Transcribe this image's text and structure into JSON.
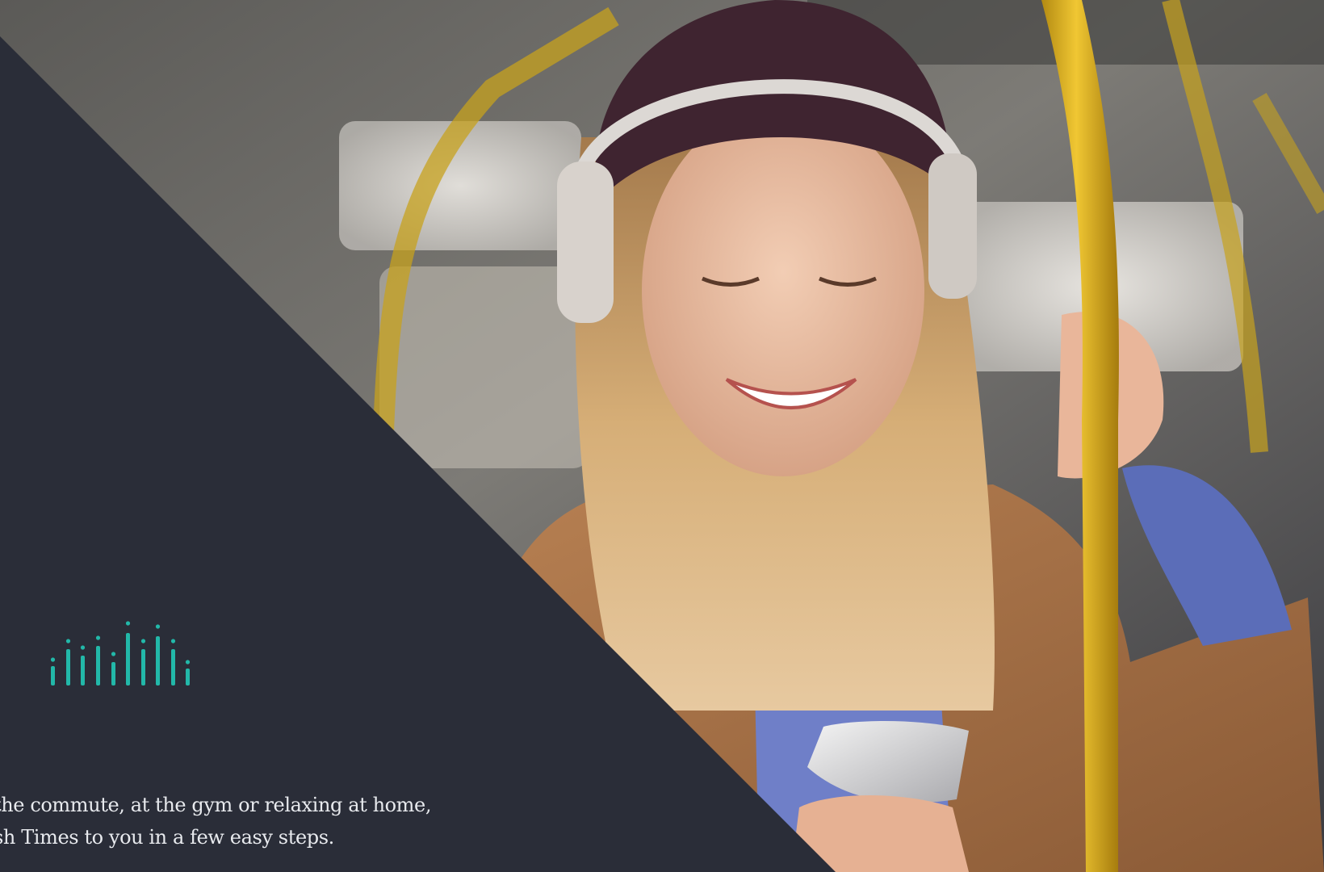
{
  "hero": {
    "photo_alt": "Woman wearing headphones smiling at her phone while holding a yellow pole on public transport",
    "logo_icon": "audio-waveform-icon",
    "copy_line_1": "the commute, at the gym or relaxing at home,",
    "copy_line_2": "sh Times to you in a few easy steps."
  },
  "colors": {
    "panel": "#2a2d38",
    "accent": "#22b8a9",
    "text": "#e8eaee"
  }
}
